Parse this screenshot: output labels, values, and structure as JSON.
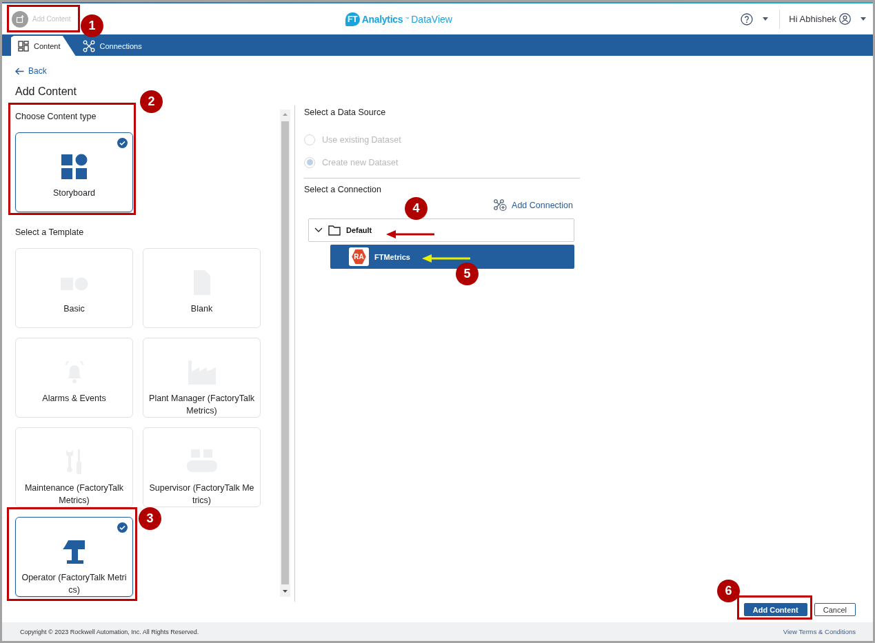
{
  "header": {
    "add_content": {
      "label": "Add Content",
      "disabled": true
    },
    "logo": {
      "badge": "FT",
      "name": "Analytics",
      "tm": "™",
      "product": "DataView"
    },
    "user": "Hi Abhishek"
  },
  "nav_tabs": [
    {
      "label": "Content",
      "selected": true,
      "kind": "content"
    },
    {
      "label": "Connections",
      "selected": false,
      "kind": "connections"
    }
  ],
  "back": "Back",
  "title": "Add Content",
  "content_type": {
    "heading": "Choose Content type",
    "options": [
      {
        "label": "Storyboard",
        "selected": true,
        "kind": "storyboard"
      }
    ]
  },
  "templates": {
    "heading": "Select a Template",
    "items": [
      {
        "label": "Basic",
        "selected": false,
        "kind": "basic"
      },
      {
        "label": "Blank",
        "selected": false,
        "kind": "blank"
      },
      {
        "label": "Alarms & Events",
        "selected": false,
        "kind": "alarm"
      },
      {
        "label": "Plant Manager (FactoryTalk Metrics)",
        "selected": false,
        "kind": "factory"
      },
      {
        "label": "Maintenance (FactoryTalk Metrics)",
        "selected": false,
        "kind": "tools"
      },
      {
        "label": "Supervisor (FactoryTalk Metrics)",
        "selected": false,
        "kind": "conveyor"
      },
      {
        "label": "Operator (FactoryTalk Metrics)",
        "selected": true,
        "kind": "operator"
      }
    ]
  },
  "data_source": {
    "heading": "Select a Data Source",
    "disabled": true,
    "options": [
      {
        "label": "Use existing Dataset",
        "selected": false
      },
      {
        "label": "Create new Dataset",
        "selected": true
      }
    ]
  },
  "connection": {
    "heading": "Select a Connection",
    "add": "Add Connection",
    "tree": [
      {
        "label": "Default",
        "expanded": true,
        "children": [
          {
            "label": "FTMetrics",
            "logo": "RA",
            "selected": true
          }
        ]
      }
    ]
  },
  "buttons": [
    {
      "label": "Add Content",
      "kind": "primary"
    },
    {
      "label": "Cancel",
      "kind": "secondary"
    }
  ],
  "footer": {
    "copyright": "Copyright © 2023 Rockwell Automation, Inc. All Rights Reserved.",
    "terms": "View Terms & Conditions"
  },
  "callouts": [
    {
      "number": "1"
    },
    {
      "number": "2"
    },
    {
      "number": "3"
    },
    {
      "number": "4"
    },
    {
      "number": "5"
    },
    {
      "number": "6"
    }
  ],
  "arrows": [
    {
      "color": "#c00000"
    },
    {
      "color": "#e8f000"
    }
  ]
}
